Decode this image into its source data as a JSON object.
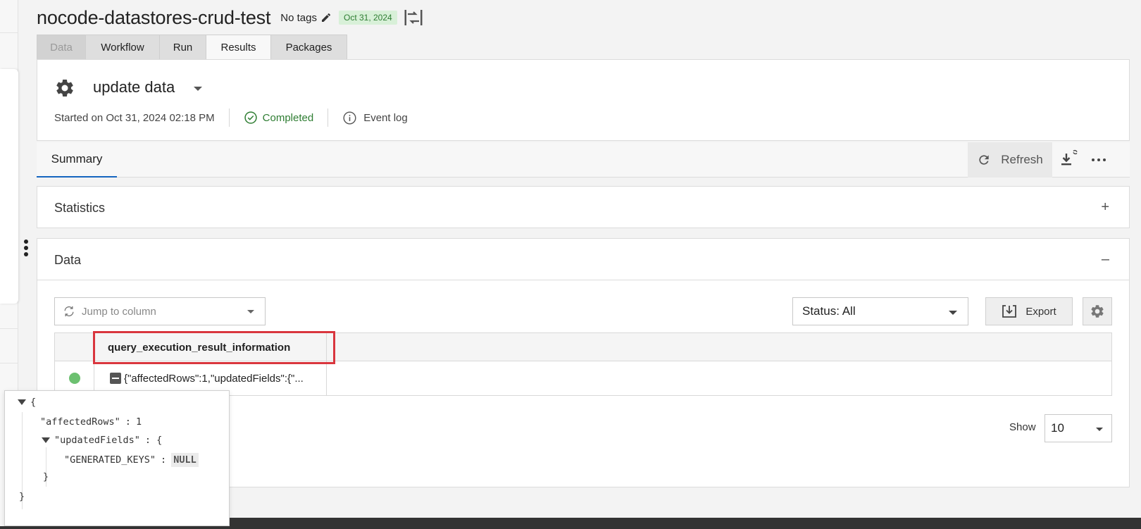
{
  "workflow": {
    "title": "nocode-datastores-crud-test",
    "tags_label": "No tags",
    "date_badge": "Oct 31, 2024"
  },
  "tabs": [
    {
      "label": "Data",
      "state": "disabled"
    },
    {
      "label": "Workflow",
      "state": "normal"
    },
    {
      "label": "Run",
      "state": "normal"
    },
    {
      "label": "Results",
      "state": "active"
    },
    {
      "label": "Packages",
      "state": "normal"
    }
  ],
  "run": {
    "name": "update data",
    "started": "Started on Oct 31, 2024 02:18 PM",
    "status": "Completed",
    "event_log": "Event log"
  },
  "summary_bar": {
    "tab": "Summary",
    "refresh": "Refresh"
  },
  "sections": {
    "statistics": {
      "label": "Statistics",
      "toggle": "+"
    },
    "data": {
      "label": "Data",
      "toggle": "–"
    }
  },
  "data_panel": {
    "jump_placeholder": "Jump to column",
    "status_filter": "Status: All",
    "export": "Export",
    "column_header": "query_execution_result_information",
    "rows": [
      {
        "status": "success",
        "value": "{\"affectedRows\":1,\"updatedFields\":{\"..."
      }
    ],
    "show_label": "Show",
    "page_size": "10"
  },
  "json_popup": {
    "open_brace": "{",
    "affected_key": "\"affectedRows\"",
    "affected_sep": ":",
    "affected_value": "1",
    "updated_key": "\"updatedFields\"",
    "updated_sep": ": {",
    "keys_key": "\"GENERATED_KEYS\"",
    "keys_sep": ":",
    "keys_value": "NULL",
    "inner_close": "}",
    "outer_close": "}"
  },
  "colors": {
    "accent": "#1565c0",
    "success": "#2e7d32",
    "highlight_box": "#d9363e",
    "status_dot": "#6cc070"
  }
}
